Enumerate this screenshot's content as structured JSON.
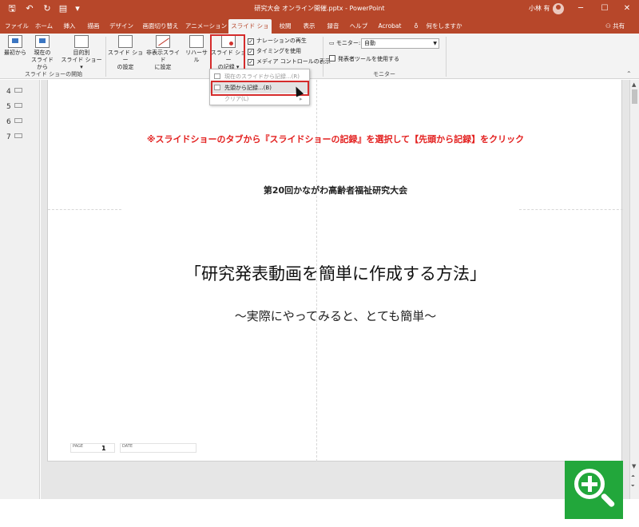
{
  "titlebar": {
    "doc_title": "研究大会 オンライン開催.pptx - PowerPoint",
    "user_name": "小林 有",
    "minimize": "─",
    "restore": "☐",
    "close": "✕",
    "qat_more": "▾"
  },
  "tabs": [
    {
      "label": "ファイル"
    },
    {
      "label": "ホーム"
    },
    {
      "label": "挿入"
    },
    {
      "label": "描画"
    },
    {
      "label": "デザイン"
    },
    {
      "label": "画面切り替え"
    },
    {
      "label": "アニメーション"
    },
    {
      "label": "スライド ショー"
    },
    {
      "label": "校閲"
    },
    {
      "label": "表示"
    },
    {
      "label": "録音"
    },
    {
      "label": "ヘルプ"
    },
    {
      "label": "Acrobat"
    },
    {
      "label": "何をしますか"
    }
  ],
  "share_label": "共有",
  "ribbon": {
    "btn_from_start": "最初から",
    "btn_from_current_1": "現在の",
    "btn_from_current_2": "スライドから",
    "btn_custom_1": "目的別",
    "btn_custom_2": "スライド ショー ▾",
    "group_start": "スライド ショーの開始",
    "btn_setup_1": "スライド ショー",
    "btn_setup_2": "の設定",
    "btn_hide_1": "非表示スライド",
    "btn_hide_2": "に設定",
    "btn_rehearse": "リハーサル",
    "btn_record_1": "スライド ショー",
    "btn_record_2": "の記録 ▾",
    "chk_narration": "ナレーションの再生",
    "chk_timing": "タイミングを使用",
    "chk_media": "メディア コントロールの表示",
    "monitor_label": "モニター:",
    "monitor_value": "自動",
    "chk_presenter": "発表者ツールを使用する",
    "group_monitor": "モニター"
  },
  "dropdown": {
    "item_current": "現在のスライドから記録...(R)",
    "item_start": "先頭から記録...(B)",
    "item_clear": "クリア(L)"
  },
  "thumbnails": [
    "4",
    "5",
    "6",
    "7"
  ],
  "slide": {
    "instruction": "※スライドショーのタブから『スライドショーの記録』を選択して【先頭から記録】をクリック",
    "conference": "第20回かながわ高齢者福祉研究大会",
    "title": "「研究発表動画を簡単に作成する方法」",
    "subtitle": "〜実際にやってみると、とても簡単〜",
    "footer_page_label": "PAGE",
    "footer_page_value": "1",
    "footer_date_label": "DATE"
  },
  "colors": {
    "accent": "#b7472a",
    "highlight": "#d52b2b",
    "zoom_button": "#22a73b"
  }
}
